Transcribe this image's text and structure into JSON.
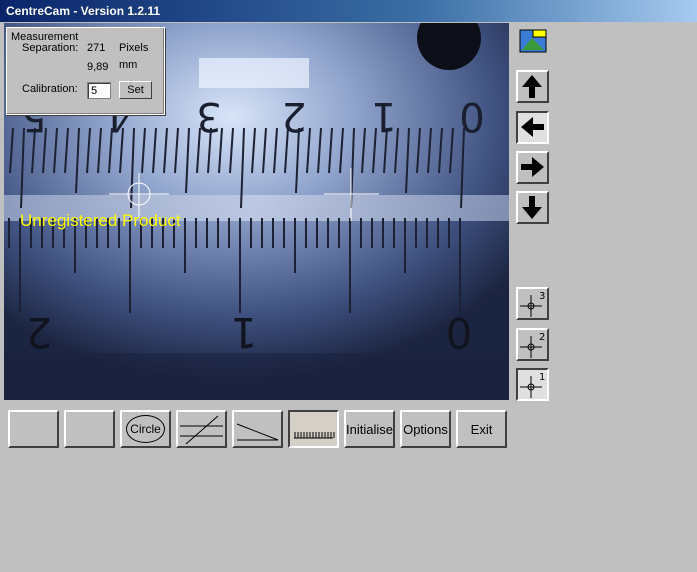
{
  "window": {
    "title": "CentreCam - Version 1.2.11"
  },
  "measurement": {
    "heading": "Measurement",
    "separation_label": "Separation:",
    "separation_value": "271",
    "separation_unit": "Pixels",
    "mm_value": "9,89",
    "mm_unit": "mm",
    "calibration_label": "Calibration:",
    "calibration_value": "5",
    "set_label": "Set"
  },
  "overlay": {
    "watermark": "Unregistered Product"
  },
  "ruler": {
    "upper_labels": [
      "0",
      "1",
      "2",
      "3",
      "4",
      "5"
    ],
    "lower_labels": [
      "0",
      "1",
      "2"
    ]
  },
  "toolbar": {
    "blank1": "",
    "blank2": "",
    "circle_label": "Circle",
    "initialise_label": "Initialise",
    "options_label": "Options",
    "exit_label": "Exit"
  },
  "side_buttons": {
    "icons": [
      "camera-icon",
      "arrow-up-icon",
      "arrow-left-icon",
      "arrow-right-icon",
      "arrow-down-icon"
    ],
    "crosshair_labels": [
      "3",
      "2",
      "1"
    ]
  }
}
